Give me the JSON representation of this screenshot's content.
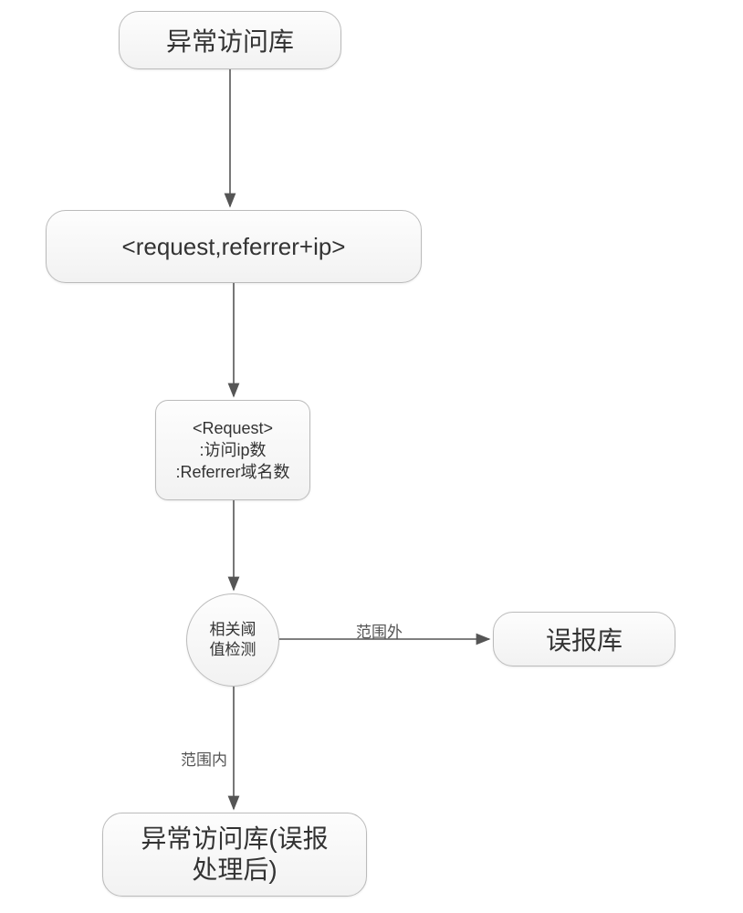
{
  "nodes": {
    "n1": {
      "label": "异常访问库"
    },
    "n2": {
      "label": "<request,referrer+ip>"
    },
    "n3": {
      "label": "<Request>\n:访问ip数\n:Referrer域名数"
    },
    "n4": {
      "label": "相关阈\n值检测"
    },
    "n5": {
      "label": "误报库"
    },
    "n6": {
      "label": "异常访问库(误报\n处理后)"
    }
  },
  "edges": {
    "e_inrange": {
      "label": "范围内"
    },
    "e_outrange": {
      "label": "范围外"
    }
  },
  "chart_data": {
    "type": "flowchart",
    "nodes": [
      {
        "id": "n1",
        "label": "异常访问库",
        "shape": "rounded-rect"
      },
      {
        "id": "n2",
        "label": "<request,referrer+ip>",
        "shape": "rounded-rect"
      },
      {
        "id": "n3",
        "label": "<Request> :访问ip数 :Referrer域名数",
        "shape": "rounded-rect"
      },
      {
        "id": "n4",
        "label": "相关阈值检测",
        "shape": "circle"
      },
      {
        "id": "n5",
        "label": "误报库",
        "shape": "rounded-rect"
      },
      {
        "id": "n6",
        "label": "异常访问库(误报处理后)",
        "shape": "rounded-rect"
      }
    ],
    "edges": [
      {
        "from": "n1",
        "to": "n2",
        "label": ""
      },
      {
        "from": "n2",
        "to": "n3",
        "label": ""
      },
      {
        "from": "n3",
        "to": "n4",
        "label": ""
      },
      {
        "from": "n4",
        "to": "n5",
        "label": "范围外"
      },
      {
        "from": "n4",
        "to": "n6",
        "label": "范围内"
      }
    ]
  }
}
